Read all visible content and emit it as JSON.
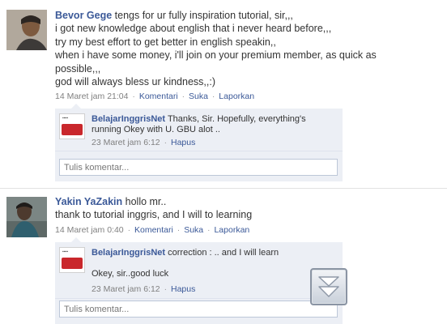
{
  "posts": [
    {
      "author": "Bevor Gege",
      "lines": [
        "tengs for ur fully inspiration tutorial, sir,,,",
        "i got new knowledge about english that i never heard before,,,",
        "try my best effort to get better in english speakin,,",
        "when i have some money, i'll join on your premium member, as quick as",
        "possible,,,",
        "god will always bless ur kindness,,:)"
      ],
      "timestamp": "14 Maret jam 21:04",
      "actions": [
        "Komentari",
        "Suka",
        "Laporkan"
      ],
      "reply": {
        "author": "BelajarInggrisNet",
        "lines": [
          "Thanks, Sir. Hopefully, everything's",
          "running Okey with U. GBU alot .."
        ],
        "timestamp": "23 Maret jam 6:12",
        "delete_label": "Hapus"
      },
      "comment_placeholder": "Tulis komentar..."
    },
    {
      "author": "Yakin YaZakin",
      "lines": [
        "hollo mr..",
        "thank to tutorial inggris, and I will to learning"
      ],
      "timestamp": "14 Maret jam 0:40",
      "actions": [
        "Komentari",
        "Suka",
        "Laporkan"
      ],
      "reply": {
        "author": "BelajarInggrisNet",
        "lines": [
          "correction : .. and I will learn",
          "",
          "Okey, sir..good luck"
        ],
        "timestamp": "23 Maret jam 6:12",
        "delete_label": "Hapus"
      },
      "comment_placeholder": "Tulis komentar..."
    }
  ],
  "colors": {
    "link": "#3b5998",
    "reply_background": "#eceff5",
    "meta_text": "#808080"
  },
  "icons": {
    "scroll_button": "double-chevron-down-icon"
  }
}
